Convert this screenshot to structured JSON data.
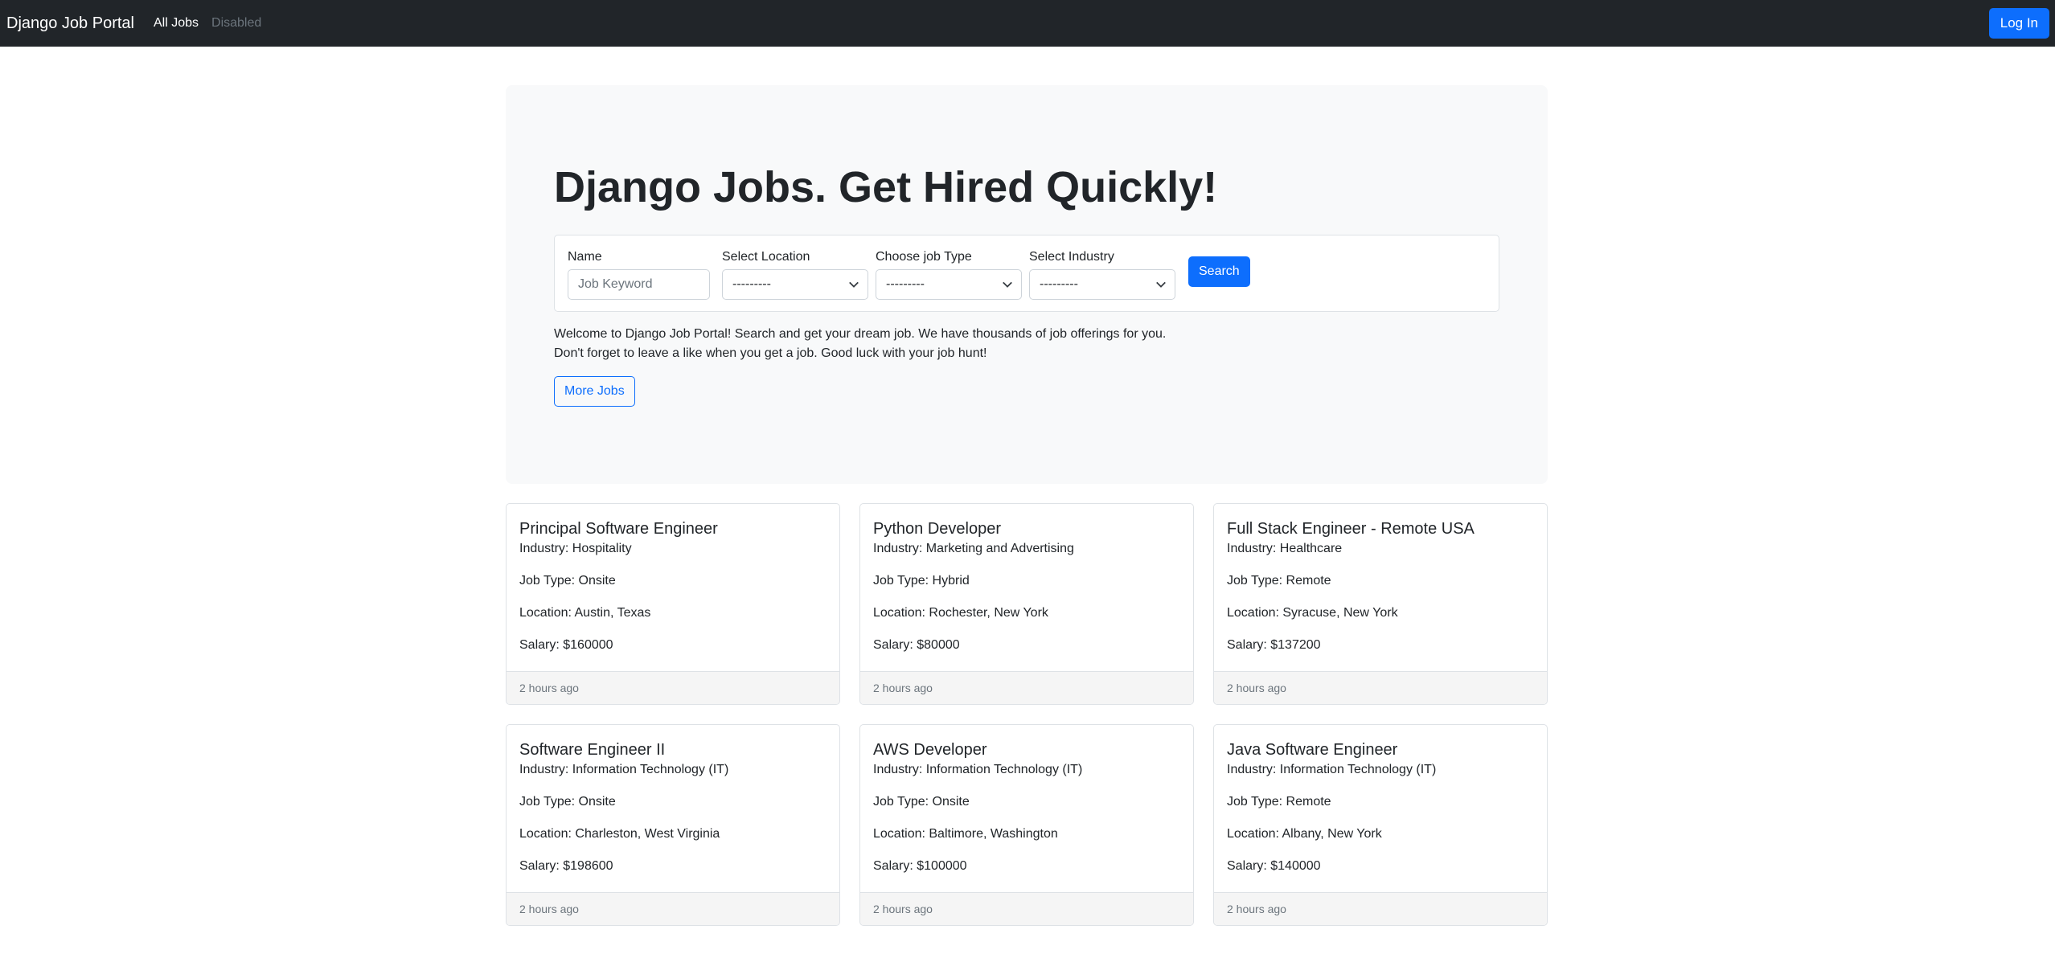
{
  "navbar": {
    "brand": "Django Job Portal",
    "links": [
      "All Jobs",
      "Disabled"
    ],
    "login_label": "Log In"
  },
  "hero": {
    "title": "Django Jobs. Get Hired Quickly!",
    "search": {
      "name_label": "Name",
      "name_placeholder": "Job Keyword",
      "location_label": "Select Location",
      "location_value": "---------",
      "jobtype_label": "Choose job Type",
      "jobtype_value": "---------",
      "industry_label": "Select Industry",
      "industry_value": "---------",
      "search_label": "Search"
    },
    "welcome_line1": "Welcome to Django Job Portal! Search and get your dream job. We have thousands of job offerings for you.",
    "welcome_line2": "Don't forget to leave a like when you get a job. Good luck with your job hunt!",
    "more_jobs_label": "More Jobs"
  },
  "jobs": [
    {
      "title": "Principal Software Engineer",
      "industry": "Industry: Hospitality",
      "job_type": "Job Type: Onsite",
      "location": "Location: Austin, Texas",
      "salary": "Salary: $160000",
      "posted": "2 hours ago"
    },
    {
      "title": "Python Developer",
      "industry": "Industry: Marketing and Advertising",
      "job_type": "Job Type: Hybrid",
      "location": "Location: Rochester, New York",
      "salary": "Salary: $80000",
      "posted": "2 hours ago"
    },
    {
      "title": "Full Stack Engineer - Remote USA",
      "industry": "Industry: Healthcare",
      "job_type": "Job Type: Remote",
      "location": "Location: Syracuse, New York",
      "salary": "Salary: $137200",
      "posted": "2 hours ago"
    },
    {
      "title": "Software Engineer II",
      "industry": "Industry: Information Technology (IT)",
      "job_type": "Job Type: Onsite",
      "location": "Location: Charleston, West Virginia",
      "salary": "Salary: $198600",
      "posted": "2 hours ago"
    },
    {
      "title": "AWS Developer",
      "industry": "Industry: Information Technology (IT)",
      "job_type": "Job Type: Onsite",
      "location": "Location: Baltimore, Washington",
      "salary": "Salary: $100000",
      "posted": "2 hours ago"
    },
    {
      "title": "Java Software Engineer",
      "industry": "Industry: Information Technology (IT)",
      "job_type": "Job Type: Remote",
      "location": "Location: Albany, New York",
      "salary": "Salary: $140000",
      "posted": "2 hours ago"
    }
  ],
  "colors": {
    "navbar_bg": "#212529",
    "primary": "#0d6efd",
    "hero_bg": "#f8f9fa",
    "muted": "#6c757d"
  }
}
